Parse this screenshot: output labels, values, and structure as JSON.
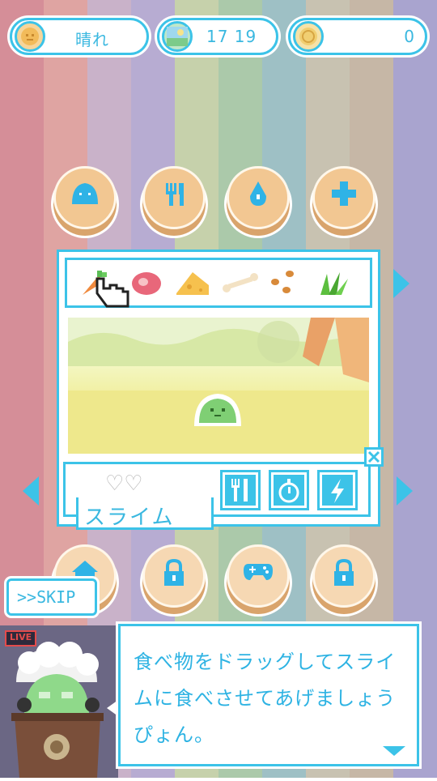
{
  "status_bar": {
    "weather": {
      "icon": "sun-face-icon",
      "label": "晴れ"
    },
    "clock": {
      "icon": "landscape-icon",
      "time": "17 19"
    },
    "coins": {
      "icon": "coin-icon",
      "count": "0"
    }
  },
  "actions_top": [
    {
      "icon": "slime-icon"
    },
    {
      "icon": "fork-knife-icon"
    },
    {
      "icon": "water-drop-icon"
    },
    {
      "icon": "plus-icon"
    }
  ],
  "food_items": [
    {
      "icon": "carrot-icon"
    },
    {
      "icon": "meat-icon"
    },
    {
      "icon": "cheese-icon"
    },
    {
      "icon": "bone-icon"
    },
    {
      "icon": "nuts-icon"
    },
    {
      "icon": "grass-icon"
    }
  ],
  "pet": {
    "name": "スライム",
    "hearts_label": "♡♡"
  },
  "pet_actions": [
    {
      "icon": "fork-knife-icon"
    },
    {
      "icon": "clock-icon"
    },
    {
      "icon": "lightning-icon"
    }
  ],
  "actions_bottom": [
    {
      "icon": "house-icon",
      "locked": false
    },
    {
      "icon": "lock-icon",
      "locked": true
    },
    {
      "icon": "gamepad-icon",
      "locked": false
    },
    {
      "icon": "lock-icon",
      "locked": true
    }
  ],
  "skip_button": {
    "label": ">>SKIP"
  },
  "live_badge": "LIVE",
  "dialog": {
    "text": "食べ物をドラッグしてスライムに食べさせてあげましょうぴょん。"
  },
  "colors": {
    "accent": "#3cc3e8",
    "button_face": "#f2c792",
    "stripes": [
      "#d58e98",
      "#dfa4a2",
      "#c9b2c9",
      "#b7acd2",
      "#c6d1ab",
      "#abc9aa",
      "#9ec0c5",
      "#c8c2b1",
      "#c6b7a6",
      "#a9a4cf"
    ]
  }
}
